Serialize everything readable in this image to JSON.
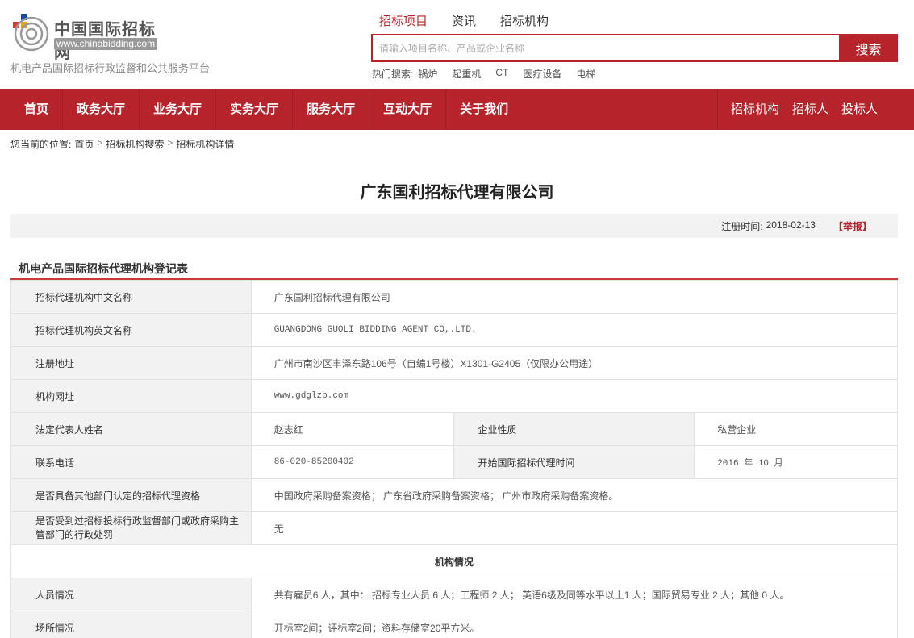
{
  "header": {
    "logo_cn": "中国国际招标网",
    "logo_en": "www.chinabidding.com",
    "slogan": "机电产品国际招标行政监督和公共服务平台",
    "search_tabs": [
      "招标项目",
      "资讯",
      "招标机构"
    ],
    "search_placeholder": "请输入项目名称、产品或企业名称",
    "search_button": "搜索",
    "hot_label": "热门搜索:",
    "hot_items": [
      "锅炉",
      "起重机",
      "CT",
      "医疗设备",
      "电梯"
    ]
  },
  "nav": {
    "left": [
      "首页",
      "政务大厅",
      "业务大厅",
      "实务大厅",
      "服务大厅",
      "互动大厅",
      "关于我们"
    ],
    "right": [
      "招标机构",
      "招标人",
      "投标人"
    ]
  },
  "breadcrumb": {
    "label": "您当前的位置:",
    "items": [
      "首页",
      "招标机构搜索",
      "招标机构详情"
    ]
  },
  "page": {
    "title": "广东国利招标代理有限公司",
    "reg_time_label": "注册时间:",
    "reg_time": "2018-02-13",
    "report": "【举报】",
    "section_title": "机电产品国际招标代理机构登记表"
  },
  "table": {
    "cn_name_label": "招标代理机构中文名称",
    "cn_name": "广东国利招标代理有限公司",
    "en_name_label": "招标代理机构英文名称",
    "en_name": "GUANGDONG GUOLI BIDDING AGENT CO,.LTD.",
    "address_label": "注册地址",
    "address": "广州市南沙区丰泽东路106号（自编1号楼）X1301-G2405（仅限办公用途）",
    "website_label": "机构网址",
    "website": "www.gdglzb.com",
    "legal_rep_label": "法定代表人姓名",
    "legal_rep": "赵志红",
    "nature_label": "企业性质",
    "nature": "私营企业",
    "phone_label": "联系电话",
    "phone": "86-020-85200402",
    "start_label": "开始国际招标代理时间",
    "start": "2016 年 10 月",
    "qual_label": "是否具备其他部门认定的招标代理资格",
    "qual": "中国政府采购备案资格；  广东省政府采购备案资格；  广州市政府采购备案资格。",
    "penalty_label": "是否受到过招标投标行政监督部门或政府采购主管部门的行政处罚",
    "penalty": "无",
    "org_section": "机构情况",
    "staff_label": "人员情况",
    "staff": "共有雇员6 人，其中： 招标专业人员 6 人；工程师 2 人； 英语6级及同等水平以上1 人；国际贸易专业 2 人；其他 0 人。",
    "site_label": "场所情况",
    "site": "开标室2间；评标室2间；资料存储室20平方米。"
  }
}
